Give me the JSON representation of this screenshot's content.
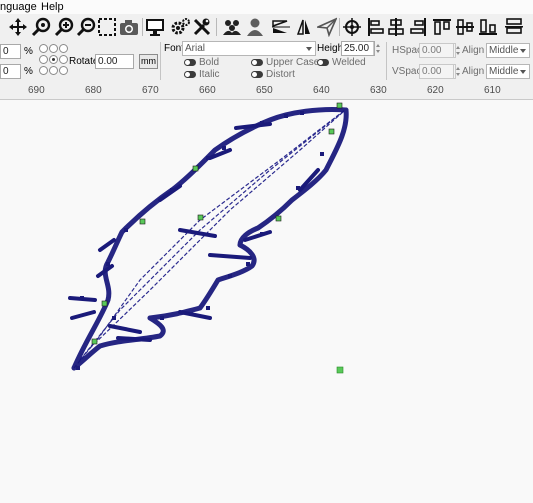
{
  "menu": {
    "language": "nguage",
    "help": "Help"
  },
  "toolbar": {
    "icons": [
      "move-icon",
      "zoom-icon",
      "zoom-in-icon",
      "zoom-out-icon",
      "select-rect-icon",
      "camera-icon",
      "monitor-icon",
      "settings-gear-icon",
      "tools-icon",
      "users-icon",
      "user-icon",
      "flip-vertical-icon",
      "flip-horizontal-icon",
      "send-icon",
      "target-icon",
      "align-left-icon",
      "align-center-icon",
      "align-right-icon",
      "align-top-icon",
      "align-middle-icon",
      "align-bottom-icon"
    ]
  },
  "props": {
    "width_value": "0",
    "height_value": "0",
    "percent_symbol": "%",
    "rotate_label": "Rotate",
    "rotate_value": "0.00",
    "mm_label": "mm",
    "font_label": "Font",
    "font_value": "Arial",
    "height_label": "Height",
    "height_text_value": "25.00",
    "bold_label": "Bold",
    "italic_label": "Italic",
    "upper_case_label": "Upper Case",
    "distort_label": "Distort",
    "welded_label": "Welded",
    "hspace_label": "HSpace",
    "hspace_value": "0.00",
    "vspace_label": "VSpace",
    "vspace_value": "0.00",
    "align_x_label": "Align X",
    "align_x_value": "Middle",
    "align_y_label": "Align Y",
    "align_y_value": "Middle"
  },
  "ruler": {
    "ticks": [
      "690",
      "680",
      "670",
      "660",
      "650",
      "640",
      "630",
      "620",
      "610"
    ]
  },
  "colors": {
    "path_fill": "#1a1a7a",
    "path_line": "#2b2b8f",
    "node_green": "#59c959"
  }
}
